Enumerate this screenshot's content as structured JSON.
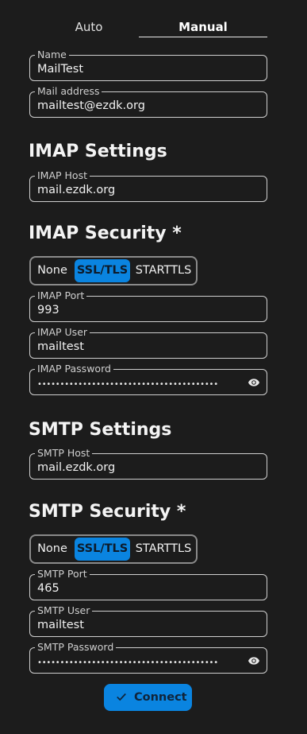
{
  "tabs": {
    "auto": "Auto",
    "manual": "Manual"
  },
  "name": {
    "label": "Name",
    "value": "MailTest"
  },
  "mail_address": {
    "label": "Mail address",
    "value": "mailtest@ezdk.org"
  },
  "imap": {
    "heading": "IMAP Settings",
    "host": {
      "label": "IMAP Host",
      "value": "mail.ezdk.org"
    },
    "security_heading": "IMAP Security *",
    "security_options": [
      "None",
      "SSL/TLS",
      "STARTTLS"
    ],
    "security_selected": "SSL/TLS",
    "port": {
      "label": "IMAP Port",
      "value": "993"
    },
    "user": {
      "label": "IMAP User",
      "value": "mailtest"
    },
    "password": {
      "label": "IMAP Password",
      "value": "••••••••••••••••••••••••••••••••••••••••"
    }
  },
  "smtp": {
    "heading": "SMTP Settings",
    "host": {
      "label": "SMTP Host",
      "value": "mail.ezdk.org"
    },
    "security_heading": "SMTP Security *",
    "security_options": [
      "None",
      "SSL/TLS",
      "STARTTLS"
    ],
    "security_selected": "SSL/TLS",
    "port": {
      "label": "SMTP Port",
      "value": "465"
    },
    "user": {
      "label": "SMTP User",
      "value": "mailtest"
    },
    "password": {
      "label": "SMTP Password",
      "value": "••••••••••••••••••••••••••••••••••••••••"
    }
  },
  "connect_label": "Connect",
  "icons": {
    "eye": "eye-icon",
    "check": "check-icon"
  },
  "colors": {
    "accent": "#0a84e0",
    "background": "#1c1c1c"
  }
}
